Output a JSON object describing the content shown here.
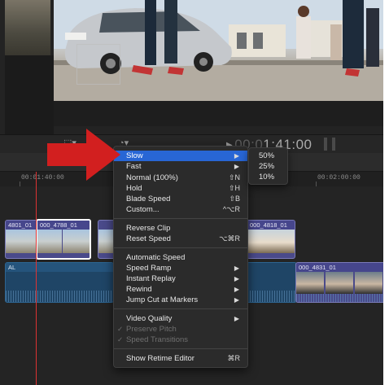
{
  "timecode": {
    "bright": "00:01:41:00",
    "dim": "00:0",
    "value": "1:41:00"
  },
  "ruler": {
    "left": "00:01:40:00",
    "right": "00:02:00:00"
  },
  "clips": {
    "c1": "4801_01",
    "c2": "000_4788_01",
    "c3": "000_4818_01",
    "audio1": "AL",
    "audio2": "000_4831_01"
  },
  "menu": {
    "items": [
      {
        "label": "Slow",
        "shortcut": "",
        "submenu": true,
        "highlighted": true
      },
      {
        "label": "Fast",
        "shortcut": "",
        "submenu": true
      },
      {
        "label": "Normal (100%)",
        "shortcut": "⇧N"
      },
      {
        "label": "Hold",
        "shortcut": "⇧H"
      },
      {
        "label": "Blade Speed",
        "shortcut": "⇧B"
      },
      {
        "label": "Custom...",
        "shortcut": "^⌥R"
      },
      {
        "label": "Reverse Clip",
        "shortcut": ""
      },
      {
        "label": "Reset Speed",
        "shortcut": "⌥⌘R"
      },
      {
        "label": "Automatic Speed",
        "shortcut": ""
      },
      {
        "label": "Speed Ramp",
        "shortcut": "",
        "submenu": true
      },
      {
        "label": "Instant Replay",
        "shortcut": "",
        "submenu": true
      },
      {
        "label": "Rewind",
        "shortcut": "",
        "submenu": true
      },
      {
        "label": "Jump Cut at Markers",
        "shortcut": "",
        "submenu": true
      },
      {
        "label": "Video Quality",
        "shortcut": "",
        "submenu": true
      },
      {
        "label": "Preserve Pitch",
        "disabled": true,
        "checked": true
      },
      {
        "label": "Speed Transitions",
        "disabled": true,
        "checked": true
      },
      {
        "label": "Show Retime Editor",
        "shortcut": "⌘R"
      }
    ],
    "submenu": [
      "50%",
      "25%",
      "10%"
    ]
  },
  "colors": {
    "highlight": "#2866d5",
    "arrow": "#d21f1f",
    "playhead": "#dd3333"
  }
}
